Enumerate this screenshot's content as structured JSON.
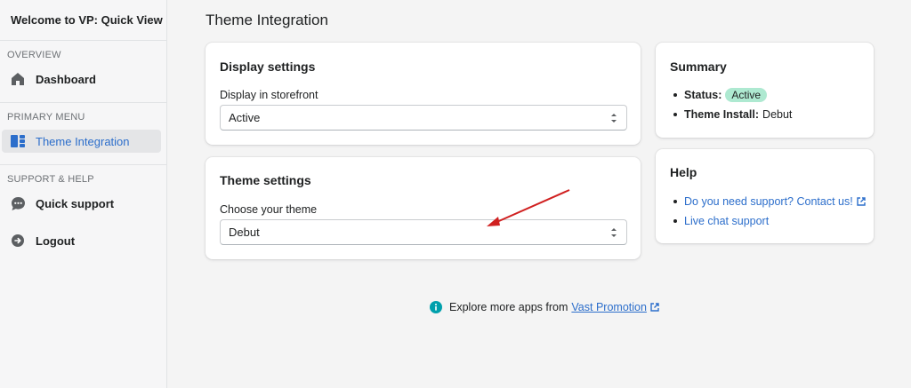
{
  "sidebar": {
    "app_title": "Welcome to VP: Quick View",
    "sections": {
      "overview": {
        "title": "OVERVIEW",
        "items": [
          {
            "label": "Dashboard",
            "icon": "home-icon"
          }
        ]
      },
      "primary": {
        "title": "PRIMARY MENU",
        "items": [
          {
            "label": "Theme Integration",
            "icon": "layout-icon",
            "active": true
          }
        ]
      },
      "support": {
        "title": "SUPPORT & HELP",
        "items": [
          {
            "label": "Quick support",
            "icon": "chat-icon"
          },
          {
            "label": "Logout",
            "icon": "logout-icon"
          }
        ]
      }
    }
  },
  "main": {
    "page_title": "Theme Integration",
    "display_settings": {
      "heading": "Display settings",
      "field_label": "Display in storefront",
      "value": "Active"
    },
    "theme_settings": {
      "heading": "Theme settings",
      "field_label": "Choose your theme",
      "value": "Debut"
    },
    "summary": {
      "heading": "Summary",
      "status_label": "Status:",
      "status_value": "Active",
      "theme_install_label": "Theme Install:",
      "theme_install_value": "Debut"
    },
    "help": {
      "heading": "Help",
      "links": [
        "Do you need support? Contact us!",
        "Live chat support"
      ]
    },
    "footer": {
      "text": "Explore more apps from",
      "link": "Vast Promotion"
    }
  },
  "colors": {
    "accent": "#2c6ecb",
    "badge_success": "#aee9d1",
    "info_icon": "#00a0ac",
    "annotation_arrow": "#d02020"
  }
}
